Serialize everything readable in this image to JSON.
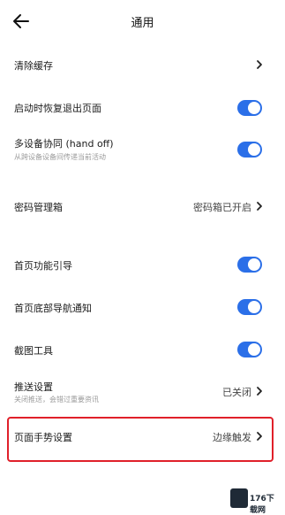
{
  "header": {
    "title": "通用",
    "back_icon": "arrow-left-icon"
  },
  "settings": [
    {
      "label": "清除缓存",
      "type": "chevron"
    },
    {
      "label": "启动时恢复退出页面",
      "type": "toggle",
      "on": true
    },
    {
      "label": "多设备协同 (hand off)",
      "sub": "从跨设备设备间传递当前活动",
      "type": "toggle",
      "on": true
    },
    {
      "label": "密码管理箱",
      "value": "密码箱已开启",
      "type": "chevron"
    },
    {
      "label": "首页功能引导",
      "type": "toggle",
      "on": true
    },
    {
      "label": "首页底部导航通知",
      "type": "toggle",
      "on": true
    },
    {
      "label": "截图工具",
      "type": "toggle",
      "on": true
    },
    {
      "label": "推送设置",
      "sub": "关闭推送，会错过重要资讯",
      "value": "已关闭",
      "type": "chevron"
    },
    {
      "label": "页面手势设置",
      "value": "边缘触发",
      "type": "chevron"
    }
  ],
  "colors": {
    "toggle_on": "#2b6fe8",
    "highlight": "#e0202a"
  },
  "watermark": {
    "text": "176下载网"
  }
}
